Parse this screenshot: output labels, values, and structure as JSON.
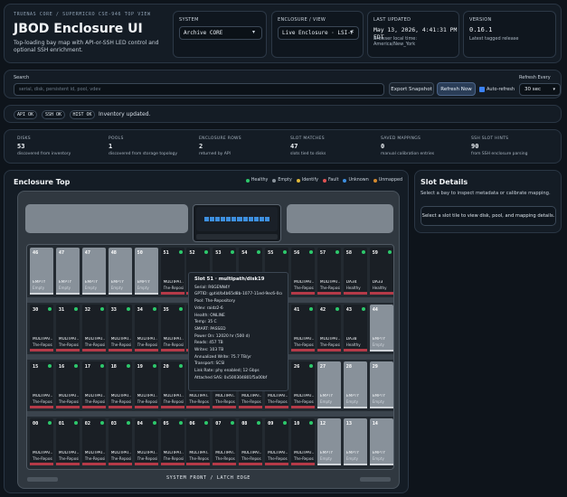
{
  "header": {
    "eyebrow": "TRUENAS CORE / SUPERMICRO CSE-946 TOP VIEW",
    "title": "JBOD Enclosure UI",
    "subtitle": "Top-loading bay map with API-or-SSH LED control and optional SSH enrichment.",
    "system_label": "SYSTEM",
    "system_value": "Archive CORE",
    "enclosure_label": "ENCLOSURE / VIEW",
    "enclosure_value": "Live Enclosure · LSI-F SAS",
    "last_updated_label": "LAST UPDATED",
    "last_updated_value": "May 13, 2026, 4:41:31 PM EDT",
    "last_updated_note": "Browser local time: America/New_York",
    "version_label": "VERSION",
    "version_value": "0.16.1",
    "version_note": "Latest tagged release"
  },
  "search": {
    "label": "Search",
    "placeholder": "serial, disk, persistent id, pool, vdev",
    "export_label": "Export Snapshot",
    "refresh_label": "Refresh Now",
    "auto_refresh_label": "Auto-refresh",
    "refresh_every_label": "Refresh Every",
    "refresh_every_value": "30 sec"
  },
  "status": {
    "pills": [
      "API OK",
      "SSH OK",
      "HIST OK"
    ],
    "message": "Inventory updated."
  },
  "stats": [
    {
      "key": "DISKS",
      "value": "53",
      "desc": "discovered from inventory"
    },
    {
      "key": "POOLS",
      "value": "1",
      "desc": "discovered from storage topology"
    },
    {
      "key": "ENCLOSURE ROWS",
      "value": "2",
      "desc": "returned by API"
    },
    {
      "key": "SLOT MATCHES",
      "value": "47",
      "desc": "slots tied to disks"
    },
    {
      "key": "SAVED MAPPINGS",
      "value": "0",
      "desc": "manual calibration entries"
    },
    {
      "key": "SSH SLOT HINTS",
      "value": "90",
      "desc": "from SSH enclosure parsing"
    }
  ],
  "enclosure": {
    "title": "Enclosure Top",
    "legend": [
      {
        "label": "Healthy",
        "color": "#2dc86b"
      },
      {
        "label": "Empty",
        "color": "#8a939c"
      },
      {
        "label": "Identify",
        "color": "#e0b83a"
      },
      {
        "label": "Fault",
        "color": "#e05252"
      },
      {
        "label": "Unknown",
        "color": "#3d8fe0"
      },
      {
        "label": "Unmapped",
        "color": "#d68a2e"
      }
    ],
    "bottom_label": "SYSTEM FRONT / LATCH EDGE",
    "rows": [
      [
        {
          "num": "46",
          "state": "empty",
          "t1": "EMPTY",
          "t2": "Empty"
        },
        {
          "num": "47",
          "state": "empty",
          "t1": "EMPTY",
          "t2": "Empty"
        },
        {
          "num": "47",
          "state": "empty",
          "t1": "EMPTY",
          "t2": "Empty"
        },
        {
          "num": "48",
          "state": "empty",
          "t1": "EMPTY",
          "t2": "Empty"
        },
        {
          "num": "50",
          "state": "empty",
          "t1": "EMPTY",
          "t2": "Empty"
        },
        {
          "num": "51",
          "state": "filled",
          "t1": "MULTIPAT...",
          "t2": "The-Reposi..."
        },
        {
          "num": "52",
          "state": "filled",
          "t1": "MULTIPAT...",
          "t2": "The-Reposi..."
        },
        {
          "num": "53",
          "state": "filled",
          "t1": "MULTIPAT...",
          "t2": "The-Reposi..."
        },
        {
          "num": "54",
          "state": "filled",
          "t1": "MULTIPAT...",
          "t2": "The-Reposi..."
        },
        {
          "num": "55",
          "state": "filled",
          "t1": "MULTIPAT...",
          "t2": "The-Reposi..."
        },
        {
          "num": "56",
          "state": "filled",
          "t1": "MULTIPAT...",
          "t2": "The-Reposi..."
        },
        {
          "num": "57",
          "state": "filled",
          "t1": "MULTIPAT...",
          "t2": "The-Reposi..."
        },
        {
          "num": "58",
          "state": "filled",
          "t1": "DA34",
          "t2": "Healthy"
        },
        {
          "num": "59",
          "state": "filled",
          "t1": "DA33",
          "t2": "Healthy"
        }
      ],
      [
        {
          "num": "30",
          "state": "filled",
          "t1": "MULTIPAT...",
          "t2": "The-Reposi..."
        },
        {
          "num": "31",
          "state": "filled",
          "t1": "MULTIPAT...",
          "t2": "The-Reposi..."
        },
        {
          "num": "32",
          "state": "filled",
          "t1": "MULTIPAT...",
          "t2": "The-Reposi..."
        },
        {
          "num": "33",
          "state": "filled",
          "t1": "MULTIPAT...",
          "t2": "The-Reposi..."
        },
        {
          "num": "34",
          "state": "filled",
          "t1": "MULTIPAT...",
          "t2": "The-Reposi..."
        },
        {
          "num": "35",
          "state": "filled",
          "t1": "MULTIPAT...",
          "t2": "The-Reposi..."
        },
        {
          "num": "36",
          "state": "filled",
          "t1": "MULTIPAT...",
          "t2": "The-Reposi..."
        },
        {
          "num": "37",
          "state": "filled",
          "t1": "MULTIPAT...",
          "t2": "The-Reposi..."
        },
        {
          "num": "38",
          "state": "filled",
          "t1": "MULTIPAT...",
          "t2": "The-Reposi..."
        },
        {
          "num": "39",
          "state": "filled",
          "t1": "MULTIPAT...",
          "t2": "The-Reposi..."
        },
        {
          "num": "41",
          "state": "filled",
          "t1": "MULTIPAT...",
          "t2": "The-Reposi..."
        },
        {
          "num": "42",
          "state": "filled",
          "t1": "MULTIPAT...",
          "t2": "The-Reposi..."
        },
        {
          "num": "43",
          "state": "filled",
          "t1": "DA38",
          "t2": "Healthy"
        },
        {
          "num": "44",
          "state": "empty",
          "t1": "EMPTY",
          "t2": "Empty"
        }
      ],
      [
        {
          "num": "15",
          "state": "filled",
          "t1": "MULTIPAT...",
          "t2": "The-Reposi..."
        },
        {
          "num": "16",
          "state": "filled",
          "t1": "MULTIPAT...",
          "t2": "The-Reposi..."
        },
        {
          "num": "17",
          "state": "filled",
          "t1": "MULTIPAT...",
          "t2": "The-Reposi..."
        },
        {
          "num": "18",
          "state": "filled",
          "t1": "MULTIPAT...",
          "t2": "The-Reposi..."
        },
        {
          "num": "19",
          "state": "filled",
          "t1": "MULTIPAT...",
          "t2": "The-Reposi..."
        },
        {
          "num": "20",
          "state": "filled",
          "t1": "MULTIPAT...",
          "t2": "The-Reposi..."
        },
        {
          "num": "21",
          "state": "filled",
          "t1": "MULTIPAT...",
          "t2": "The-Reposi..."
        },
        {
          "num": "22",
          "state": "filled",
          "t1": "MULTIPAT...",
          "t2": "The-Reposi..."
        },
        {
          "num": "23",
          "state": "filled",
          "t1": "MULTIPAT...",
          "t2": "The-Reposi..."
        },
        {
          "num": "24",
          "state": "filled",
          "t1": "MULTIPAT...",
          "t2": "The-Reposi..."
        },
        {
          "num": "26",
          "state": "filled",
          "t1": "MULTIPAT...",
          "t2": "The-Reposi..."
        },
        {
          "num": "27",
          "state": "empty",
          "t1": "EMPTY",
          "t2": "Empty"
        },
        {
          "num": "28",
          "state": "empty",
          "t1": "EMPTY",
          "t2": "Empty"
        },
        {
          "num": "29",
          "state": "empty",
          "t1": "EMPTY",
          "t2": "Empty"
        }
      ],
      [
        {
          "num": "00",
          "state": "filled",
          "t1": "MULTIPAT...",
          "t2": "The-Reposi..."
        },
        {
          "num": "01",
          "state": "filled",
          "t1": "MULTIPAT...",
          "t2": "The-Reposi..."
        },
        {
          "num": "02",
          "state": "filled",
          "t1": "MULTIPAT...",
          "t2": "The-Reposi..."
        },
        {
          "num": "03",
          "state": "filled",
          "t1": "MULTIPAT...",
          "t2": "The-Reposi..."
        },
        {
          "num": "04",
          "state": "filled",
          "t1": "MULTIPAT...",
          "t2": "The-Reposi..."
        },
        {
          "num": "05",
          "state": "filled",
          "t1": "MULTIPAT...",
          "t2": "The-Reposi..."
        },
        {
          "num": "06",
          "state": "filled",
          "t1": "MULTIPAT...",
          "t2": "The-Reposi..."
        },
        {
          "num": "07",
          "state": "filled",
          "t1": "MULTIPAT...",
          "t2": "The-Reposi..."
        },
        {
          "num": "08",
          "state": "filled",
          "t1": "MULTIPAT...",
          "t2": "The-Reposi..."
        },
        {
          "num": "09",
          "state": "filled",
          "t1": "MULTIPAT...",
          "t2": "The-Reposi..."
        },
        {
          "num": "10",
          "state": "filled",
          "t1": "MULTIPAT...",
          "t2": "The-Reposi..."
        },
        {
          "num": "12",
          "state": "empty",
          "t1": "EMPTY",
          "t2": "Empty"
        },
        {
          "num": "13",
          "state": "empty",
          "t1": "EMPTY",
          "t2": "Empty"
        },
        {
          "num": "14",
          "state": "empty",
          "t1": "EMPTY",
          "t2": "Empty"
        }
      ]
    ]
  },
  "tooltip": {
    "title": "Slot 51 · multipath/disk19",
    "lines": [
      "Serial: R6GENN4Y",
      "GPTID: gptid/b4b65d8b-1077-11ed-9ec6-0cc47a09460",
      "Pool: The-Repository",
      "Vdev: raidz2-6",
      "Health: ONLINE",
      "Temp: 35 C",
      "SMART: PASSED",
      "Power On: 12020 hr (500 d)",
      "Reads: 457 TB",
      "Writes: 103 TB",
      "Annualized Write: 75.7 TB/yr",
      "Transport: SCSI",
      "Link Rate: phy enabled; 12 Gbps",
      "Attached SAS: 0x500304801f5a00bf"
    ]
  },
  "slot_details": {
    "title": "Slot Details",
    "subtitle": "Select a bay to inspect metadata or calibrate mapping.",
    "placeholder": "Select a slot tile to view disk, pool, and mapping details."
  }
}
